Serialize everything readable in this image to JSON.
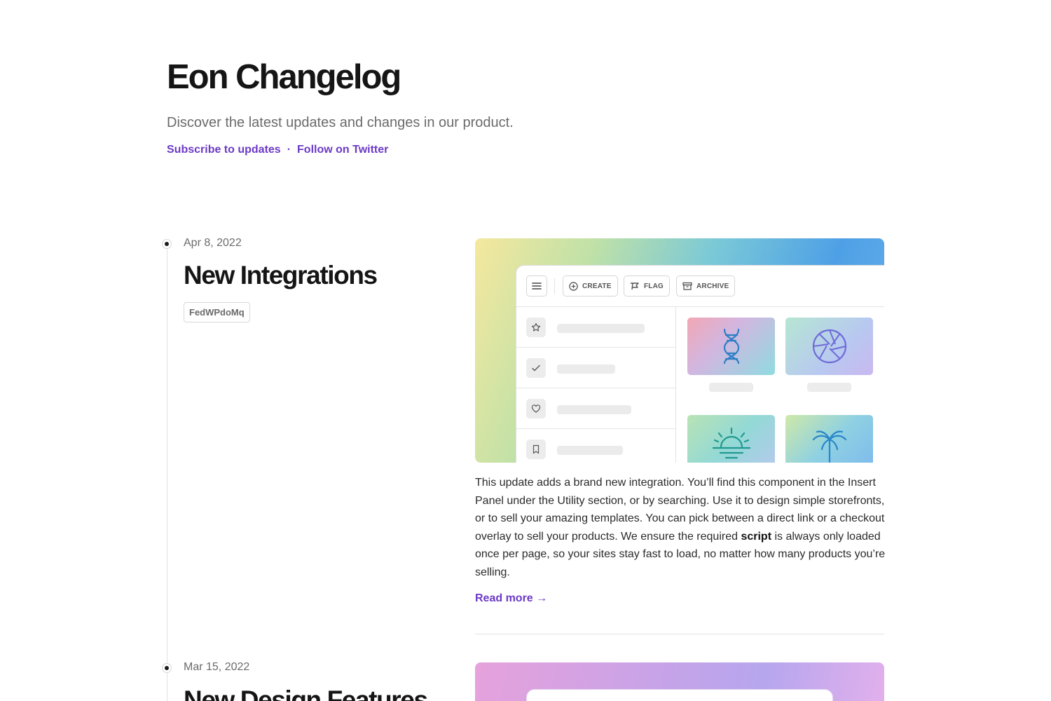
{
  "header": {
    "title": "Eon Changelog",
    "subtitle": "Discover the latest updates and changes in our product.",
    "subscribe_link": "Subscribe to updates",
    "separator": "·",
    "twitter_link": "Follow on Twitter"
  },
  "colors": {
    "accent": "#6c3ac6",
    "text": "#151515",
    "muted": "#6b6b6b"
  },
  "entries": [
    {
      "date": "Apr 8, 2022",
      "title": "New Integrations",
      "tag": "FedWPdoMq",
      "hero": {
        "toolbar": {
          "menu_icon": "menu-icon",
          "create_label": "CREATE",
          "flag_label": "FLAG",
          "archive_label": "ARCHIVE"
        },
        "list_icons": [
          "star-icon",
          "check-icon",
          "heart-icon",
          "bookmark-icon"
        ],
        "tile_icons": [
          "dna-icon",
          "aperture-icon",
          "sunrise-icon",
          "palm-tree-icon"
        ]
      },
      "body_before": "This update adds a brand new integration. You’ll find this component in the Insert Panel under the Utility section, or by searching. Use it to design simple storefronts, or to sell your amazing templates. You can pick between a direct link or a checkout overlay to sell your products. We ensure the required ",
      "body_bold": "script",
      "body_after": " is always only loaded once per page, so your sites stay fast to load, no matter how many products you’re selling.",
      "read_more": "Read more →"
    },
    {
      "date": "Mar 15, 2022",
      "title": "New Design Features"
    }
  ]
}
